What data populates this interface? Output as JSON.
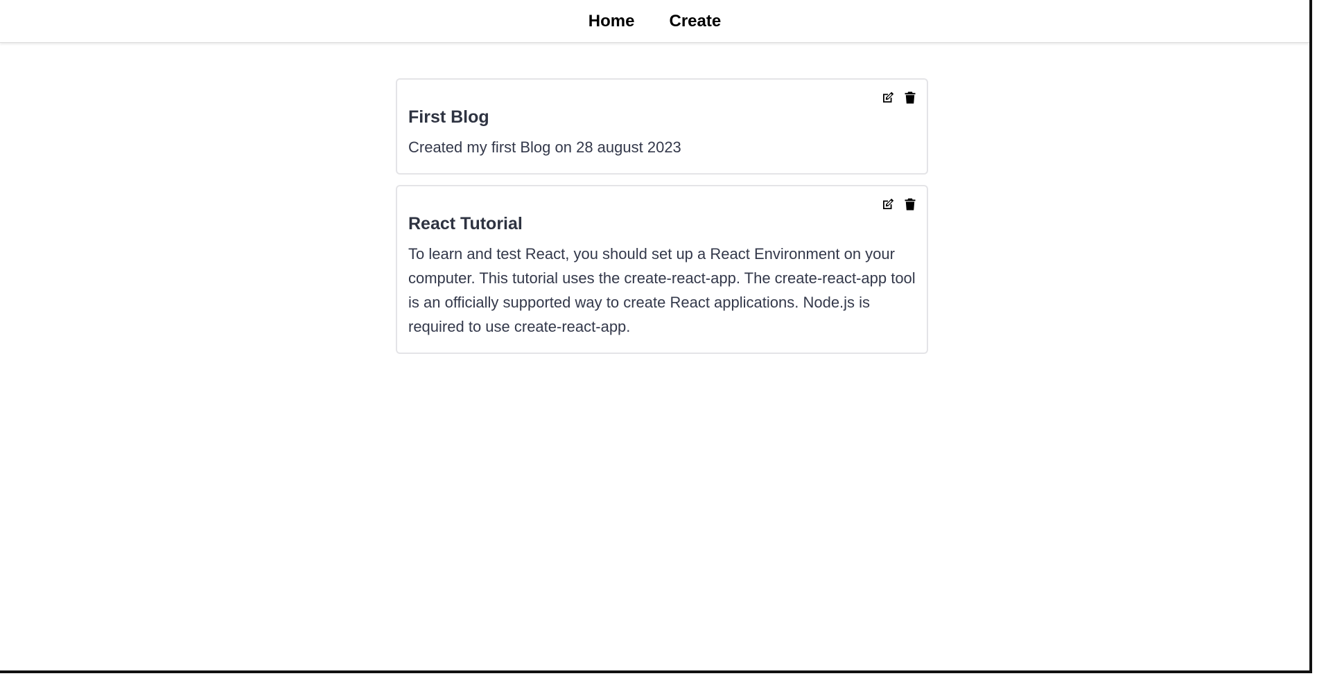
{
  "nav": {
    "home_label": "Home",
    "create_label": "Create"
  },
  "posts": [
    {
      "title": "First Blog",
      "body": "Created my first Blog on 28 august 2023",
      "edit_icon": "edit-icon",
      "delete_icon": "trash-icon"
    },
    {
      "title": "React Tutorial",
      "body": "To learn and test React, you should set up a React Environment on your computer. This tutorial uses the create-react-app. The create-react-app tool is an officially supported way to create React applications. Node.js is required to use create-react-app.",
      "edit_icon": "edit-icon",
      "delete_icon": "trash-icon"
    }
  ],
  "colors": {
    "text_dark": "#2e3341",
    "border": "#e4e4e7",
    "nav_text": "#000000"
  }
}
